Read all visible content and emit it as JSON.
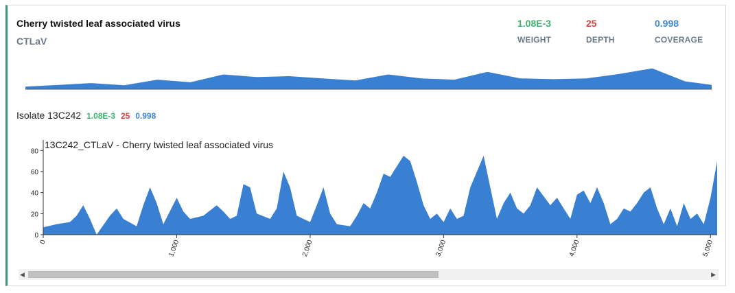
{
  "header": {
    "title": "Cherry twisted leaf associated virus",
    "abbreviation": "CTLaV"
  },
  "metrics": {
    "weight": {
      "value": "1.08E-3",
      "label": "WEIGHT"
    },
    "depth": {
      "value": "25",
      "label": "DEPTH"
    },
    "coverage": {
      "value": "0.998",
      "label": "COVERAGE"
    }
  },
  "isolate": {
    "label": "Isolate 13C242",
    "weight": "1.08E-3",
    "depth": "25",
    "coverage": "0.998"
  },
  "colors": {
    "accent": "#3a8f7c",
    "bar": "#3a80d2",
    "weight": "#3cb371",
    "depth": "#e04040",
    "coverage": "#3d87d4"
  },
  "chart_data": [
    {
      "type": "area",
      "name": "overview",
      "x": [
        0,
        250,
        500,
        750,
        1000,
        1250,
        1500,
        1750,
        2000,
        2250,
        2500,
        2750,
        3000,
        3250,
        3500,
        3750,
        4000,
        4250,
        4500,
        4750,
        5000,
        5200
      ],
      "y": [
        6,
        10,
        14,
        9,
        22,
        16,
        34,
        28,
        30,
        25,
        20,
        34,
        25,
        22,
        40,
        25,
        23,
        25,
        35,
        48,
        18,
        10
      ],
      "ylim": [
        0,
        60
      ]
    },
    {
      "type": "area",
      "title": "13C242_CTLaV - Cherry twisted leaf associated virus",
      "x": [
        0,
        100,
        200,
        250,
        300,
        350,
        400,
        500,
        550,
        600,
        700,
        750,
        800,
        850,
        900,
        1000,
        1050,
        1100,
        1200,
        1300,
        1350,
        1400,
        1450,
        1500,
        1550,
        1600,
        1700,
        1750,
        1800,
        1850,
        1900,
        2000,
        2050,
        2100,
        2150,
        2200,
        2300,
        2350,
        2400,
        2450,
        2500,
        2550,
        2600,
        2650,
        2700,
        2750,
        2800,
        2850,
        2900,
        2950,
        3000,
        3050,
        3100,
        3150,
        3200,
        3250,
        3300,
        3350,
        3400,
        3450,
        3500,
        3550,
        3600,
        3650,
        3700,
        3800,
        3850,
        3900,
        3950,
        4000,
        4050,
        4100,
        4150,
        4200,
        4250,
        4300,
        4350,
        4400,
        4450,
        4500,
        4550,
        4600,
        4650,
        4700,
        4750,
        4800,
        4850,
        4900,
        4950,
        5000,
        5050
      ],
      "y": [
        7,
        10,
        12,
        18,
        28,
        15,
        0,
        18,
        25,
        15,
        8,
        28,
        45,
        30,
        10,
        35,
        22,
        15,
        18,
        28,
        22,
        15,
        18,
        48,
        45,
        20,
        15,
        25,
        60,
        45,
        18,
        12,
        28,
        45,
        20,
        10,
        8,
        18,
        30,
        25,
        40,
        58,
        55,
        65,
        75,
        70,
        50,
        28,
        15,
        20,
        12,
        25,
        15,
        18,
        45,
        60,
        75,
        45,
        15,
        30,
        40,
        25,
        20,
        28,
        45,
        28,
        35,
        25,
        15,
        38,
        42,
        30,
        45,
        30,
        10,
        15,
        25,
        22,
        30,
        40,
        45,
        25,
        10,
        25,
        8,
        30,
        15,
        20,
        10,
        35,
        70
      ],
      "xlim": [
        0,
        5050
      ],
      "ylim": [
        0,
        90
      ],
      "yticks": [
        "0",
        "20",
        "40",
        "60",
        "80"
      ],
      "xticks": [
        "0",
        "1,000",
        "2,000",
        "3,000",
        "4,000",
        "5,000"
      ]
    }
  ],
  "scroll": {
    "left_arrow": "◀",
    "right_arrow": "▶"
  }
}
